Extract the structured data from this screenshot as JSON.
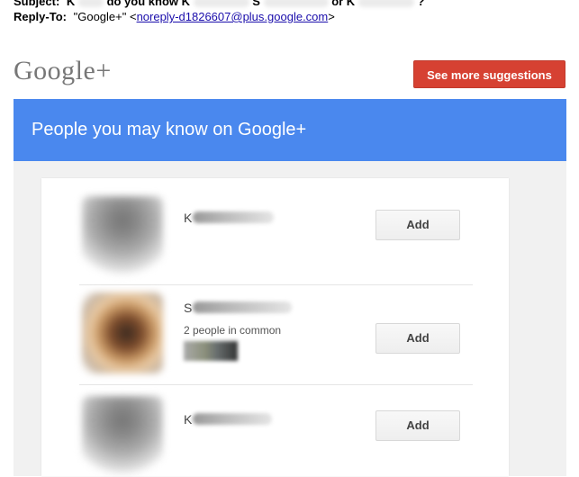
{
  "email": {
    "subject_label": "Subject:",
    "subject_text_prefix": "K",
    "subject_text_mid": "do you know K",
    "subject_text_mid2": "S",
    "subject_text_or": "or K",
    "subject_text_end": "?",
    "reply_to_label": "Reply-To:",
    "reply_to_name": "\"Google+\" <",
    "reply_to_email": "noreply-d1826607@plus.google.com",
    "reply_to_close": ">"
  },
  "header": {
    "logo_text": "Google+",
    "see_more_label": "See more suggestions"
  },
  "banner": {
    "title": "People you may know on Google+"
  },
  "people": [
    {
      "name_initial": "K",
      "common_text": "",
      "add_label": "Add"
    },
    {
      "name_initial": "S",
      "common_text": "2 people in common",
      "add_label": "Add"
    },
    {
      "name_initial": "K",
      "common_text": "",
      "add_label": "Add"
    }
  ],
  "colors": {
    "button_red": "#d64132",
    "banner_blue": "#4a88ee",
    "background_gray": "#f1f1f1"
  }
}
